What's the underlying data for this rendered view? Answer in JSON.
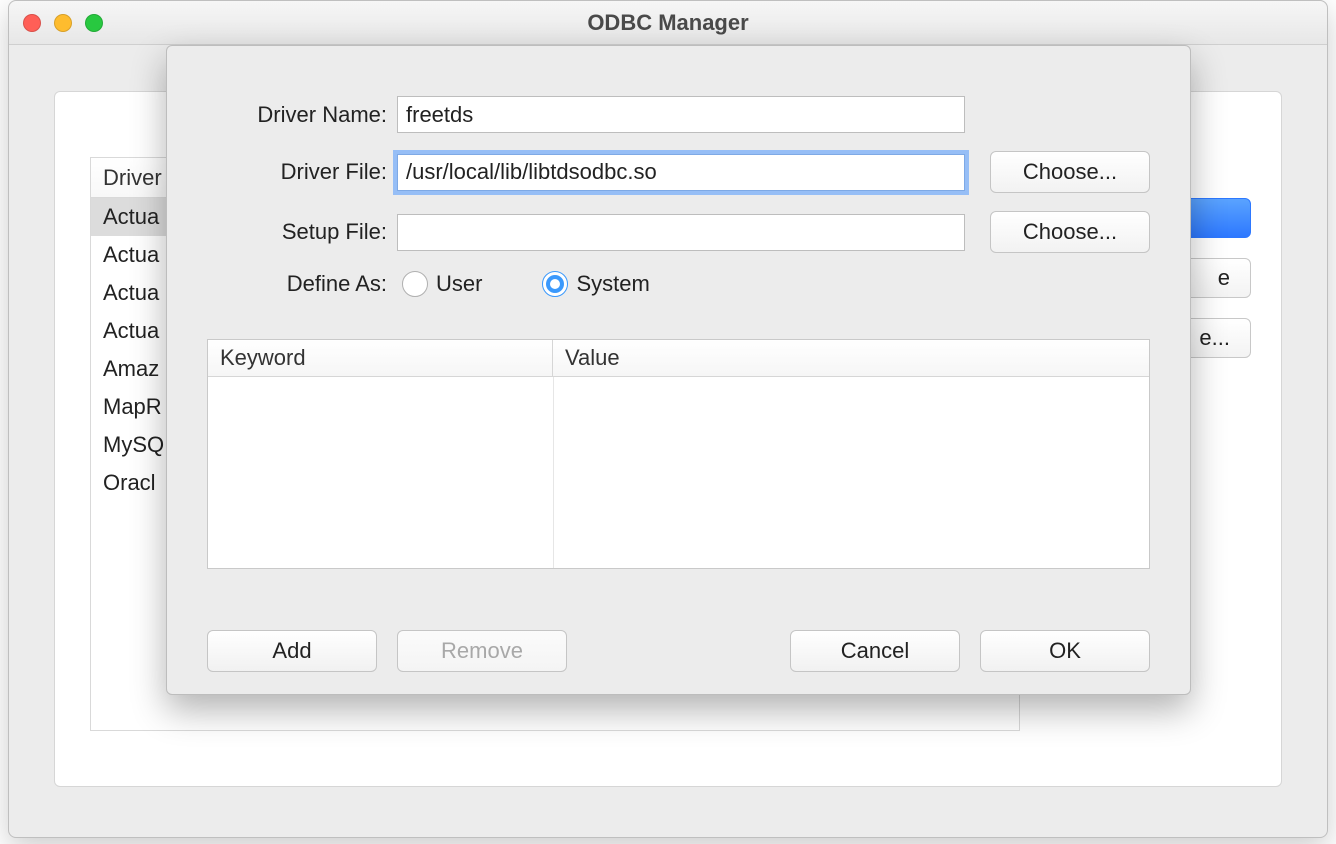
{
  "window": {
    "title": "ODBC Manager"
  },
  "driver_list": {
    "header": "Driver",
    "rows": [
      "Actua",
      "Actua",
      "Actua",
      "Actua",
      "Amaz",
      "MapR",
      "MySQ",
      "Oracl"
    ]
  },
  "side_buttons": {
    "primary": "",
    "opt1_tail": "e",
    "opt2_tail": "e..."
  },
  "dialog": {
    "labels": {
      "driver_name": "Driver Name:",
      "driver_file": "Driver File:",
      "setup_file": "Setup File:",
      "define_as": "Define As:"
    },
    "values": {
      "driver_name": "freetds",
      "driver_file": "/usr/local/lib/libtdsodbc.so",
      "setup_file": ""
    },
    "choose": "Choose...",
    "radio": {
      "user": "User",
      "system": "System",
      "selected": "system"
    },
    "kv_headers": {
      "keyword": "Keyword",
      "value": "Value"
    },
    "buttons": {
      "add": "Add",
      "remove": "Remove",
      "cancel": "Cancel",
      "ok": "OK"
    }
  }
}
